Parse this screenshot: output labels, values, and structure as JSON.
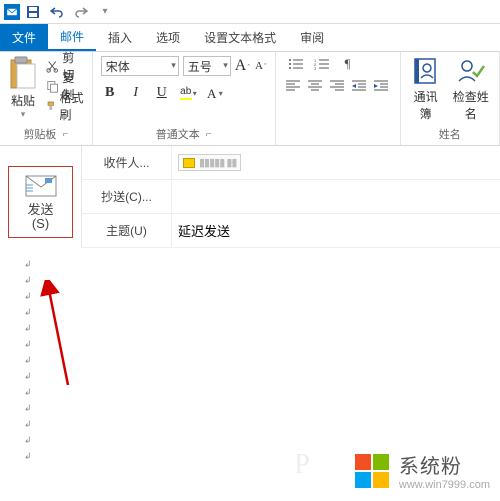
{
  "qat": {
    "save": "save-icon",
    "undo": "undo-icon",
    "redo": "redo-icon"
  },
  "tabs": {
    "file": "文件",
    "mail": "邮件",
    "insert": "插入",
    "options": "选项",
    "format_text": "设置文本格式",
    "review": "审阅"
  },
  "clipboard": {
    "paste": "粘贴",
    "cut": "剪切",
    "copy": "复制",
    "format_painter": "格式刷",
    "group_label": "剪贴板"
  },
  "font": {
    "name": "宋体",
    "size": "五号",
    "group_label": "普通文本"
  },
  "names": {
    "address_book": "通讯簿",
    "check_names": "检查姓名",
    "group_label": "姓名"
  },
  "send": {
    "label_line1": "发送",
    "label_line2": "(S)"
  },
  "fields": {
    "to_label": "收件人...",
    "cc_label": "抄送(C)...",
    "subject_label": "主题(U)",
    "subject_value": "延迟发送"
  },
  "watermark": {
    "text": "系统粉",
    "url": "www.win7999.com"
  }
}
